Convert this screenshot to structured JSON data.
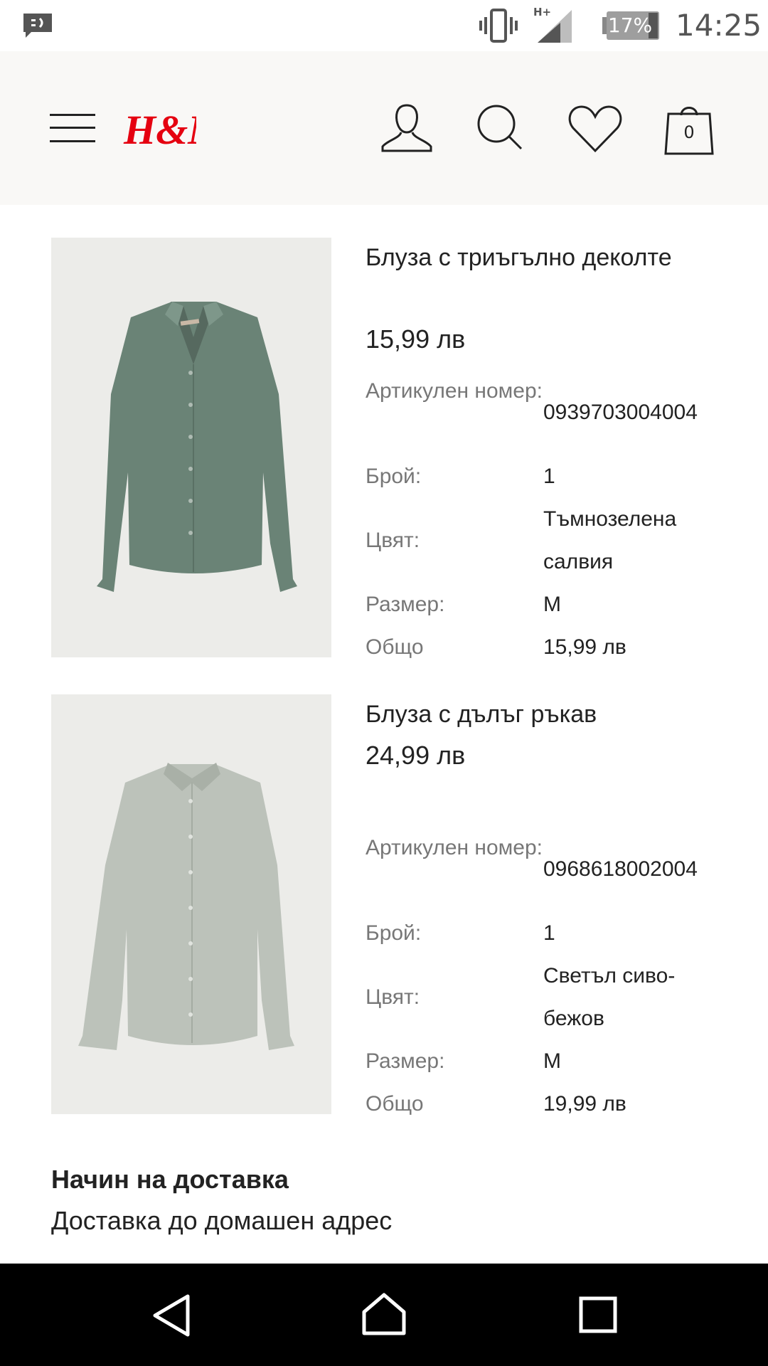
{
  "status_bar": {
    "notification_icon": "message-icon",
    "vibrate_icon": "vibrate-icon",
    "network": "H+",
    "battery": "17%",
    "time": "14:25"
  },
  "header": {
    "logo": "H&M",
    "bag_count": "0",
    "icons": [
      "menu-icon",
      "user-icon",
      "search-icon",
      "heart-icon",
      "shopping-bag-icon"
    ],
    "logo_color": "#e50010"
  },
  "products": [
    {
      "name": "Блуза с триъгълно деколте",
      "price": "15,99 лв",
      "article_label": "Артикулен номер:",
      "article_number": "0939703004004",
      "quantity_label": "Брой:",
      "quantity": "1",
      "color_label": "Цвят:",
      "color": "Тъмнозелена салвия",
      "size_label": "Размер:",
      "size": "M",
      "total_label": "Общо",
      "total": "15,99 лв",
      "shirt_color": "#6a8376"
    },
    {
      "name": "Блуза с дълъг ръкав",
      "price": "24,99 лв",
      "article_label": "Артикулен номер:",
      "article_number": "0968618002004",
      "quantity_label": "Брой:",
      "quantity": "1",
      "color_label": "Цвят:",
      "color": "Светъл сиво-бежов",
      "size_label": "Размер:",
      "size": "M",
      "total_label": "Общо",
      "total": "19,99 лв",
      "shirt_color": "#bcc2ba"
    }
  ],
  "delivery": {
    "title": "Начин на доставка",
    "value": "Доставка до домашен адрес"
  },
  "nav_bar": {
    "icons": [
      "back-icon",
      "home-icon",
      "recent-apps-icon"
    ]
  }
}
